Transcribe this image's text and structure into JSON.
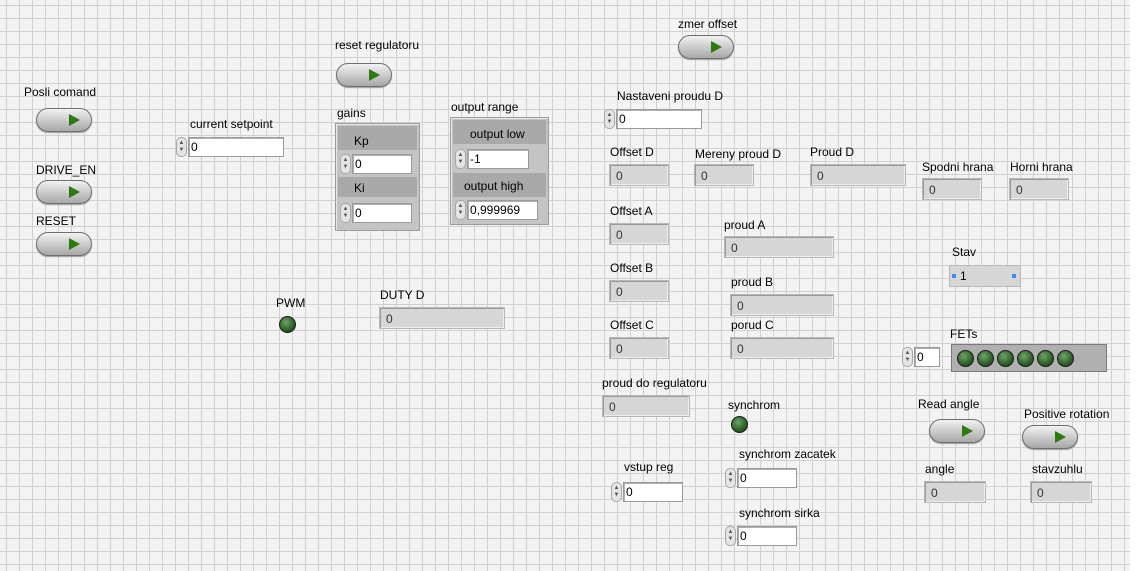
{
  "buttons": {
    "posli_comand": "Posli comand",
    "drive_en": "DRIVE_EN",
    "reset": "RESET",
    "reset_regulatoru": "reset regulatoru",
    "zmer_offset": "zmer offset",
    "read_angle": "Read angle",
    "positive_rotation": "Positive rotation"
  },
  "controls": {
    "current_setpoint": {
      "label": "current setpoint",
      "value": "0"
    },
    "nastaveni_proudu_d": {
      "label": "Nastaveni proudu D",
      "value": "0"
    },
    "vstup_reg": {
      "label": "vstup reg",
      "value": "0"
    },
    "synchrom_zacatek": {
      "label": "synchrom zacatek",
      "value": "0"
    },
    "synchrom_sirka": {
      "label": "synchrom sirka",
      "value": "0"
    },
    "fets_index": {
      "value": "0"
    }
  },
  "gains": {
    "title": "gains",
    "kp_label": "Kp",
    "kp_value": "0",
    "ki_label": "Ki",
    "ki_value": "0"
  },
  "output_range": {
    "title": "output range",
    "low_label": "output low",
    "low_value": "-1",
    "high_label": "output high",
    "high_value": "0,999969"
  },
  "indicators": {
    "duty_d": {
      "label": "DUTY D",
      "value": "0"
    },
    "offset_d": {
      "label": "Offset D",
      "value": "0"
    },
    "mereny_proud_d": {
      "label": "Mereny proud D",
      "value": "0"
    },
    "proud_d": {
      "label": "Proud D",
      "value": "0"
    },
    "spodni_hrana": {
      "label": "Spodni hrana",
      "value": "0"
    },
    "horni_hrana": {
      "label": "Horni hrana",
      "value": "0"
    },
    "offset_a": {
      "label": "Offset A",
      "value": "0"
    },
    "proud_a": {
      "label": "proud A",
      "value": "0"
    },
    "offset_b": {
      "label": "Offset B",
      "value": "0"
    },
    "proud_b": {
      "label": "proud B",
      "value": "0"
    },
    "offset_c": {
      "label": "Offset C",
      "value": "0"
    },
    "porud_c": {
      "label": "porud C",
      "value": "0"
    },
    "proud_do_regulatoru": {
      "label": "proud do regulatoru",
      "value": "0"
    },
    "angle": {
      "label": "angle",
      "value": "0"
    },
    "stavzuhlu": {
      "label": "stavzuhlu",
      "value": "0"
    },
    "stav": {
      "label": "Stav",
      "value": "1"
    }
  },
  "leds": {
    "pwm_label": "PWM",
    "synchrom_label": "synchrom",
    "fets_label": "FETs",
    "fets_count": 6
  },
  "colors": {
    "led_off": "#2d5f28",
    "button_arrow": "#2e7a12",
    "grid": "#d0d0d0",
    "panel": "#f3f3f3"
  }
}
